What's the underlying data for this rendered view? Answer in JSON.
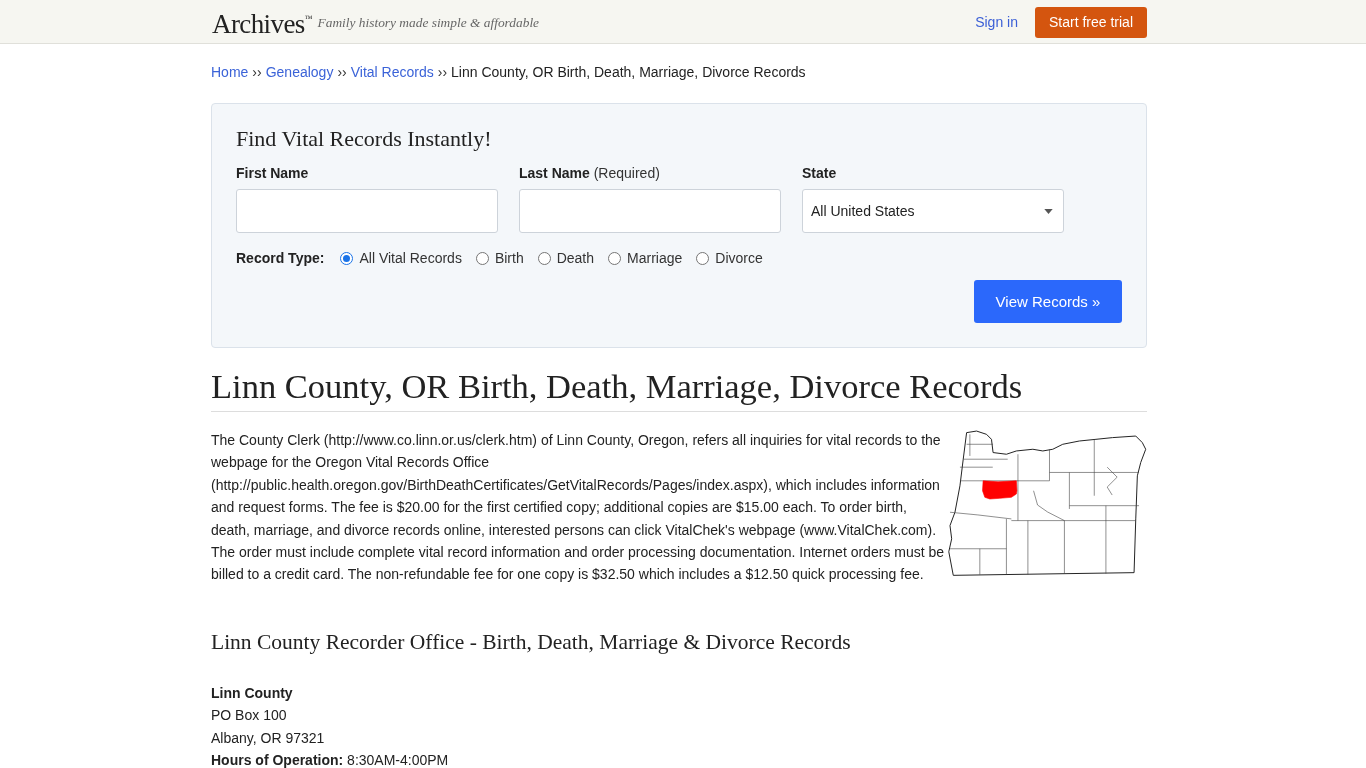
{
  "header": {
    "logo": "Archives$^{™}$",
    "tagline": "Family history made simple & affordable",
    "sign_in": "Sign in",
    "cta": "Start free trial"
  },
  "breadcrumb": [
    {
      "kind": "link",
      "label": "Home"
    },
    {
      "kind": "separator",
      "label": "››"
    },
    {
      "kind": "link",
      "label": "Genealogy"
    },
    {
      "kind": "separator",
      "label": "››"
    },
    {
      "kind": "link",
      "label": "Vital Records"
    },
    {
      "kind": "separator",
      "label": "››"
    },
    {
      "kind": "current",
      "label": "Linn County, OR Birth, Death, Marriage, Divorce Records"
    }
  ],
  "search": {
    "title": "Find Vital Records Instantly!",
    "fields": [
      {
        "kind": "text",
        "label": "First Name"
      },
      {
        "kind": "text",
        "label": "Last Name",
        "note": "(Required)"
      },
      {
        "kind": "select",
        "label": "State",
        "value": "All United States"
      }
    ],
    "record_type": {
      "label": "Record Type:",
      "options": [
        {
          "label": "All Vital Records",
          "selected": true
        },
        {
          "label": "Birth",
          "selected": false
        },
        {
          "label": "Death",
          "selected": false
        },
        {
          "label": "Marriage",
          "selected": false
        },
        {
          "label": "Divorce",
          "selected": false
        }
      ]
    },
    "submit": "View Records »"
  },
  "article": {
    "title": "Linn County, OR Birth, Death, Marriage, Divorce Records",
    "paragraph": "The County Clerk (http://www.co.linn.or.us/clerk.htm) of Linn County, Oregon, refers all inquiries for vital records to the webpage for the Oregon Vital Records Office (http://public.health.oregon.gov/BirthDeathCertificates/GetVitalRecords/Pages/index.aspx), which includes information and request forms. The fee is $20.00 for the first certified copy; additional copies are $15.00 each. To order birth, death, marriage, and divorce records online, interested persons can click VitalChek's webpage (www.VitalChek.com). The order must include complete vital record information and order processing documentation. Internet orders must be billed to a credit card. The non-refundable fee for one copy is $32.50 which includes a $12.50 quick processing fee.",
    "section_title": "Linn County Recorder Office - Birth, Death, Marriage & Divorce Records",
    "office": {
      "name": "Linn County",
      "lines": [
        "PO Box 100",
        "Albany, OR 97321"
      ],
      "hours": "**Hours of Operation:** 8:30AM-4:00PM"
    }
  }
}
